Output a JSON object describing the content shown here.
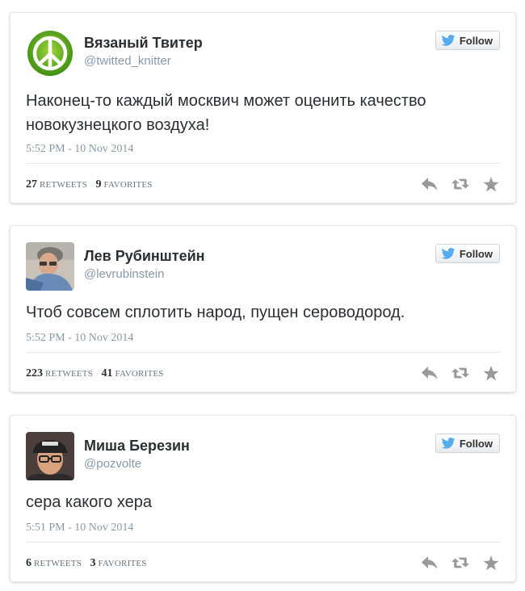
{
  "follow_label": "Follow",
  "colors": {
    "text": "#292f33",
    "muted": "#8899a6",
    "icon": "#999999",
    "border": "#e1e8ed",
    "bird": "#55acee"
  },
  "tweets": [
    {
      "display_name": "Вязаный Твитер",
      "screen_name": "@twitted_knitter",
      "avatar_icon": "peace-sign-icon",
      "text": "Наконец-то каждый москвич может оценить качество новокузнецкого воздуха!",
      "timestamp": "5:52 PM - 10 Nov 2014",
      "retweets": "27",
      "retweets_label": "RETWEETS",
      "favorites": "9",
      "favorites_label": "FAVORITES"
    },
    {
      "display_name": "Лев Рубинштейн",
      "screen_name": "@levrubinstein",
      "avatar_icon": "user-photo-avatar",
      "text": "Чтоб совсем сплотить народ, пущен сероводород.",
      "timestamp": "5:52 PM - 10 Nov 2014",
      "retweets": "223",
      "retweets_label": "RETWEETS",
      "favorites": "41",
      "favorites_label": "FAVORITES"
    },
    {
      "display_name": "Миша Березин",
      "screen_name": "@pozvolte",
      "avatar_icon": "user-photo-avatar",
      "text": "сера какого хера",
      "timestamp": "5:51 PM - 10 Nov 2014",
      "retweets": "6",
      "retweets_label": "RETWEETS",
      "favorites": "3",
      "favorites_label": "FAVORITES"
    }
  ]
}
